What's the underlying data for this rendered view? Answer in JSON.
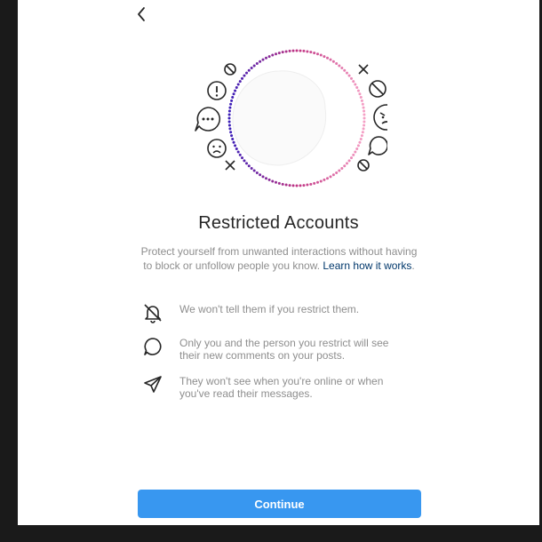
{
  "icons": {
    "back": "chevron-left-icon",
    "hero": "restricted-accounts-illustration",
    "features": [
      "muted-bell-icon",
      "comment-bubble-icon",
      "direct-message-icon"
    ]
  },
  "title": "Restricted Accounts",
  "description": {
    "text": "Protect yourself from unwanted interactions without having to block or unfollow people you know.",
    "link_label": "Learn how it works",
    "suffix": "."
  },
  "features": [
    {
      "text": "We won't tell them if you restrict them."
    },
    {
      "text": "Only you and the person you restrict will see their new comments on your posts."
    },
    {
      "text": "They won't see when you're online or when you've read their messages."
    }
  ],
  "continue_label": "Continue",
  "colors": {
    "accent": "#3897f0",
    "link": "#00376b",
    "text": "#262626",
    "muted": "#8e8e8e",
    "ring_start": "#3b1fb8",
    "ring_mid": "#c13584",
    "ring_end": "#f5a0c5"
  }
}
